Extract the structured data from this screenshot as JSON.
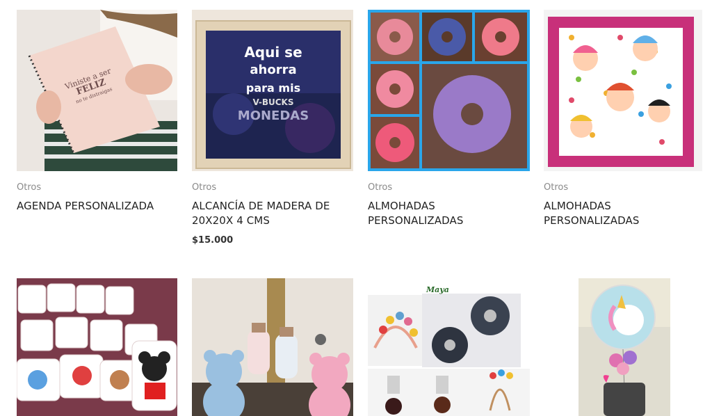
{
  "products": [
    {
      "category": "Otros",
      "title": "AGENDA PERSONALIZADA",
      "image": "notebook-photo",
      "cover_text_1": "Viniste a ser",
      "cover_text_2": "FELIZ",
      "cover_text_3": "no te distraigas"
    },
    {
      "category": "Otros",
      "title": "ALCANCÍA DE MADERA DE 20X20X 4 CMS",
      "price": "$15.000",
      "image": "wooden-piggy-bank-photo",
      "box_line_1": "Aqui se",
      "box_line_2": "ahorra",
      "box_line_3": "para mis",
      "box_line_4": "V-BUCKS",
      "box_line_5": "MONEDAS"
    },
    {
      "category": "Otros",
      "title": "ALMOHADAS PERSONALIZADAS",
      "image": "donut-pillows-photo"
    },
    {
      "category": "Otros",
      "title": "ALMOHADAS PERSONALIZADAS",
      "image": "lol-pillow-photo"
    },
    {
      "image": "character-pillows-photo"
    },
    {
      "image": "crochet-bears-photo"
    },
    {
      "image": "hair-accessories-photo",
      "brand": "Maya"
    },
    {
      "image": "unicorn-balloon-photo"
    }
  ]
}
